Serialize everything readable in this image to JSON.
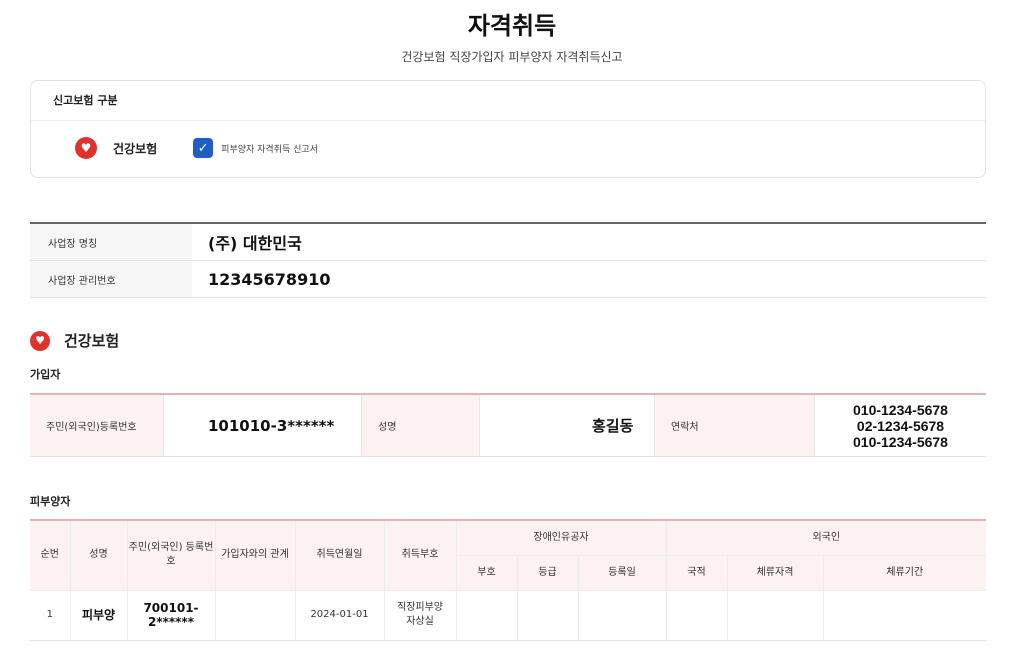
{
  "header": {
    "title": "자격취득",
    "subtitle": "건강보험 직장가입자 피부양자 자격취득신고"
  },
  "report_type": {
    "heading": "신고보험 구분",
    "insurance_name": "건강보험",
    "checkbox_label": "피부양자 자격취득 신고서",
    "checkbox_checked": true
  },
  "business": {
    "name_label": "사업장 명칭",
    "name_value": "(주) 대한민국",
    "number_label": "사업장 관리번호",
    "number_value": "12345678910"
  },
  "section": {
    "title": "건강보험",
    "subscriber_heading": "가입자",
    "dependent_heading": "피부양자"
  },
  "subscriber": {
    "id_label": "주민(외국인)등록번호",
    "id_value": "101010-3******",
    "name_label": "성명",
    "name_value": "홍길동",
    "contact_label": "연락처",
    "phones": [
      "010-1234-5678",
      "02-1234-5678",
      "010-1234-5678"
    ]
  },
  "dependents": {
    "headers": {
      "no": "순번",
      "name": "성명",
      "id": "주민(외국인) 등록번호",
      "relation": "가입자와의 관계",
      "acq_date": "취득연월일",
      "acq_code": "취득부호",
      "disabled_group": "장애인유공자",
      "disabled_code": "부호",
      "disabled_grade": "등급",
      "disabled_reg_date": "등록일",
      "foreigner_group": "외국인",
      "nationality": "국적",
      "stay_status": "체류자격",
      "stay_period": "체류기간"
    },
    "rows": [
      {
        "no": "1",
        "name": "피부양",
        "id_line1": "700101-",
        "id_line2": "2******",
        "relation": "",
        "acq_date": "2024-01-01",
        "acq_code_line1": "직장피부양",
        "acq_code_line2": "자상실",
        "disabled_code": "",
        "disabled_grade": "",
        "disabled_reg_date": "",
        "nationality": "",
        "stay_status": "",
        "stay_period": ""
      }
    ]
  },
  "colors": {
    "accent_red": "#e0312b",
    "checkbox_blue": "#1f5fc4",
    "pink_header": "#fcf2f1"
  },
  "icons": {
    "insurance": "heart-icon",
    "checkbox": "check-icon"
  }
}
